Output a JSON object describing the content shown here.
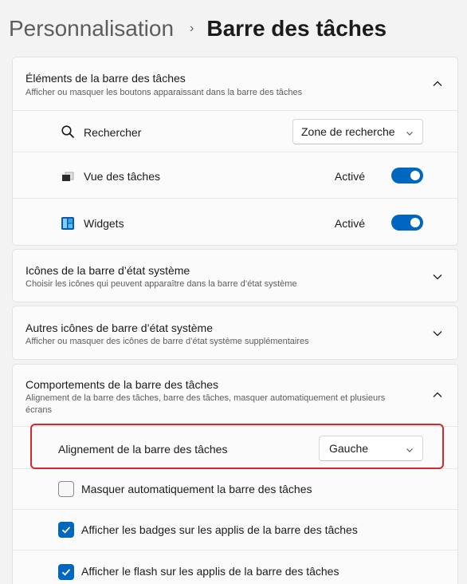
{
  "breadcrumb": {
    "parent": "Personnalisation",
    "separator": "›",
    "current": "Barre des tâches"
  },
  "sections": {
    "taskbar_items": {
      "title": "Éléments de la barre des tâches",
      "subtitle": "Afficher ou masquer les boutons apparaissant dans la barre des tâches",
      "expanded": true,
      "search": {
        "label": "Rechercher",
        "icon": "search-icon",
        "dropdown_value": "Zone de recherche"
      },
      "task_view": {
        "label": "Vue des tâches",
        "icon": "task-view-icon",
        "state": "Activé",
        "on": true
      },
      "widgets": {
        "label": "Widgets",
        "icon": "widgets-icon",
        "state": "Activé",
        "on": true
      }
    },
    "system_tray_icons": {
      "title": "Icônes de la barre d’état système",
      "subtitle": "Choisir les icônes qui peuvent apparaître dans la barre d’état système",
      "expanded": false
    },
    "other_tray_icons": {
      "title": "Autres icônes de barre d’état système",
      "subtitle": "Afficher ou masquer des icônes de barre d’état système supplémentaires",
      "expanded": false
    },
    "behaviors": {
      "title": "Comportements de la barre des tâches",
      "subtitle": "Alignement de la barre des tâches, barre des tâches, masquer automatiquement et plusieurs écrans",
      "expanded": true,
      "alignment": {
        "label": "Alignement de la barre des tâches",
        "value": "Gauche"
      },
      "auto_hide": {
        "label": "Masquer automatiquement la barre des tâches",
        "checked": false
      },
      "badges": {
        "label": "Afficher les badges sur les applis de la barre des tâches",
        "checked": true
      },
      "flash": {
        "label": "Afficher le flash sur les applis de la barre des tâches",
        "checked": true
      }
    }
  },
  "colors": {
    "accent": "#0067c0",
    "highlight": "#d9262c",
    "background": "#f3f3f3"
  }
}
